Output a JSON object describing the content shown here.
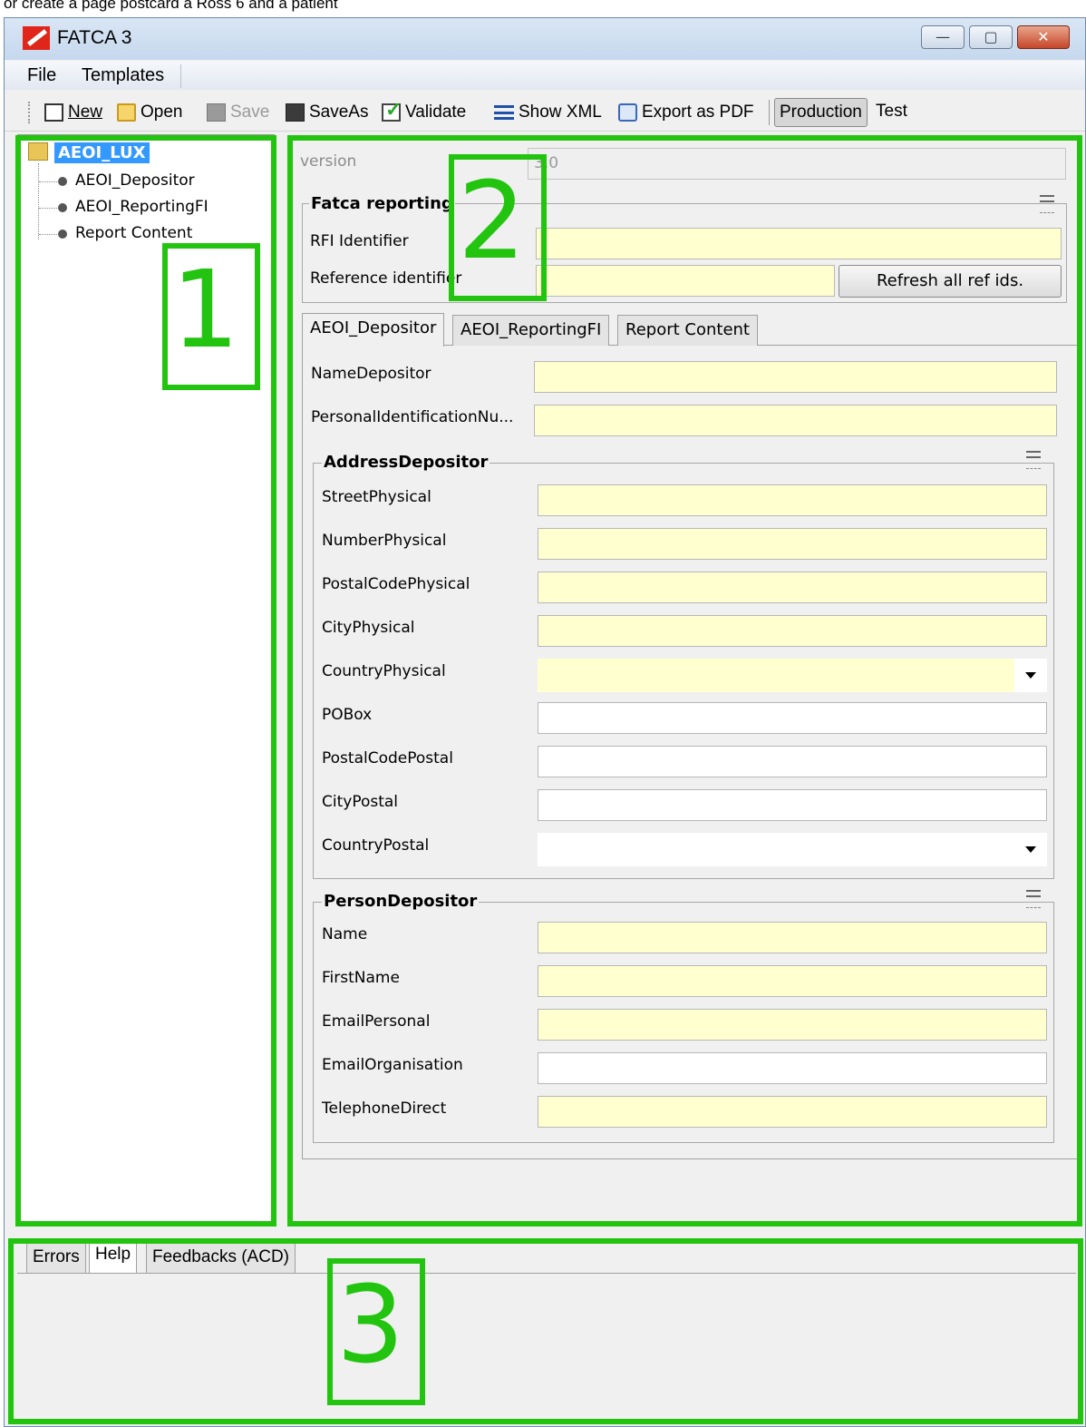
{
  "page_caption": "or create a page postcard a Ross 6 and a patient",
  "window": {
    "title": "FATCA 3"
  },
  "menu": [
    "File",
    "Templates"
  ],
  "toolbar": {
    "new": "New",
    "open": "Open",
    "save": "Save",
    "saveas": "SaveAs",
    "validate": "Validate",
    "show_xml": "Show XML",
    "export_pdf": "Export as PDF",
    "mode_production": "Production",
    "mode_test": "Test",
    "active_mode": "Production"
  },
  "tree": {
    "root": "AEOI_LUX",
    "children": [
      "AEOI_Depositor",
      "AEOI_ReportingFI",
      "Report Content"
    ]
  },
  "version": {
    "label": "version",
    "value": "3.0"
  },
  "fatca_reporting": {
    "title": "Fatca reporting",
    "rfi_label": "RFI Identifier",
    "ref_label": "Reference identifier",
    "refresh_button": "Refresh all ref ids."
  },
  "tabs": [
    "AEOI_Depositor",
    "AEOI_ReportingFI",
    "Report Content"
  ],
  "active_tab": "AEOI_Depositor",
  "depositor": {
    "name_label": "NameDepositor",
    "pin_label": "PersonalIdentificationNu..."
  },
  "address_group": {
    "title": "AddressDepositor",
    "fields": [
      "StreetPhysical",
      "NumberPhysical",
      "PostalCodePhysical",
      "CityPhysical",
      "CountryPhysical",
      "POBox",
      "PostalCodePostal",
      "CityPostal",
      "CountryPostal"
    ]
  },
  "person_group": {
    "title": "PersonDepositor",
    "fields": [
      "Name",
      "FirstName",
      "EmailPersonal",
      "EmailOrganisation",
      "TelephoneDirect"
    ]
  },
  "bottom_tabs": [
    "Errors",
    "Help",
    "Feedbacks (ACD)"
  ],
  "active_bottom_tab": "Help",
  "annotations": [
    "1",
    "2",
    "3"
  ],
  "colors": {
    "annotation_green": "#22c40f",
    "required_field": "#ffffd0",
    "tree_selection": "#3399ff",
    "close_button": "#c7462a"
  },
  "icons": [
    "fatca-app-icon",
    "new-document-icon",
    "open-folder-icon",
    "save-disk-icon",
    "saveas-disk-icon",
    "validate-check-icon",
    "xml-lines-icon",
    "pdf-printer-icon",
    "folder-icon",
    "bullet-icon",
    "collapse-icon",
    "dropdown-arrow-icon"
  ]
}
